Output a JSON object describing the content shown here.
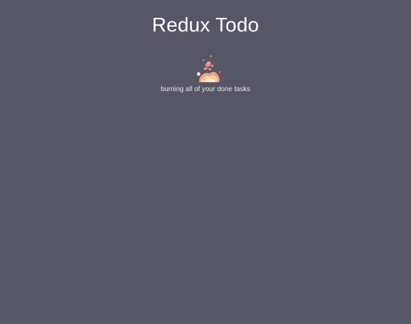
{
  "app": {
    "title": "Redux Todo"
  },
  "loader": {
    "icon": "burning-fire-icon",
    "caption": "burning all of your done tasks"
  },
  "colors": {
    "background": "#575666",
    "text": "#ffffff",
    "flame_light": "#f7cf9a",
    "flame_pink": "#f08a8a",
    "flame_peach": "#f3a585"
  }
}
